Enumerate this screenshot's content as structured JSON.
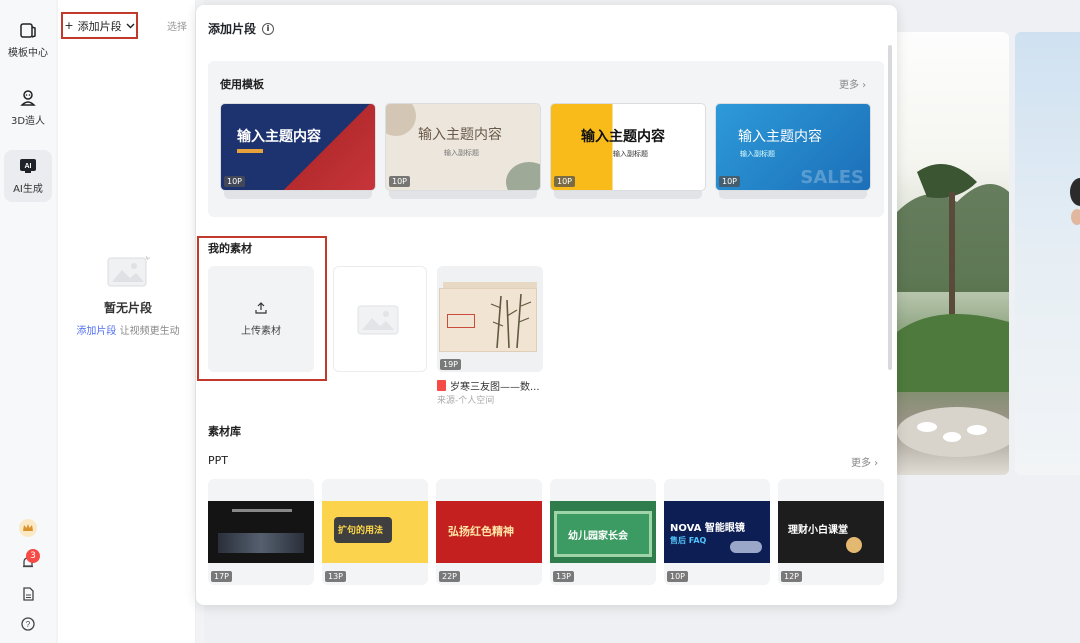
{
  "sidebar": {
    "items": [
      {
        "label": "模板中心",
        "icon": "template-icon"
      },
      {
        "label": "3D造人",
        "icon": "avatar-3d-icon"
      },
      {
        "label": "AI生成",
        "icon": "ai-icon",
        "badge_text": "AI"
      }
    ],
    "notification_count": "3",
    "bottom_icons": [
      "crown-icon",
      "bell-icon",
      "document-icon",
      "help-icon"
    ]
  },
  "segment_panel": {
    "add_button": "添加片段",
    "select_label": "选择",
    "empty_title": "暂无片段",
    "empty_link": "添加片段",
    "empty_hint": "让视频更生动"
  },
  "modal": {
    "title": "添加片段",
    "templates": {
      "title": "使用模板",
      "more": "更多",
      "cards": [
        {
          "title": "输入主题内容",
          "pages": "10P"
        },
        {
          "title": "输入主题内容",
          "subtitle": "输入副标题",
          "pages": "10P"
        },
        {
          "title": "输入主题内容",
          "subtitle": "输入副标题",
          "pages": "10P"
        },
        {
          "title": "输入主题内容",
          "subtitle": "输入副标题",
          "watermark": "SALES",
          "pages": "10P"
        }
      ]
    },
    "my_materials": {
      "title": "我的素材",
      "upload_label": "上传素材",
      "items": [
        {
          "name": "岁寒三友图——数...",
          "source": "来源-个人空间",
          "pages": "19P"
        }
      ]
    },
    "library": {
      "title": "素材库",
      "category": "PPT",
      "more": "更多",
      "items": [
        {
          "pages": "17P"
        },
        {
          "pages": "13P",
          "text": "扩句的用法"
        },
        {
          "pages": "22P",
          "text": "弘扬红色精神"
        },
        {
          "pages": "13P",
          "text": "幼儿园家长会"
        },
        {
          "pages": "10P",
          "text": "NOVA 智能眼镜",
          "sub": "售后 FAQ"
        },
        {
          "pages": "12P",
          "text": "理财小白课堂"
        }
      ]
    }
  }
}
